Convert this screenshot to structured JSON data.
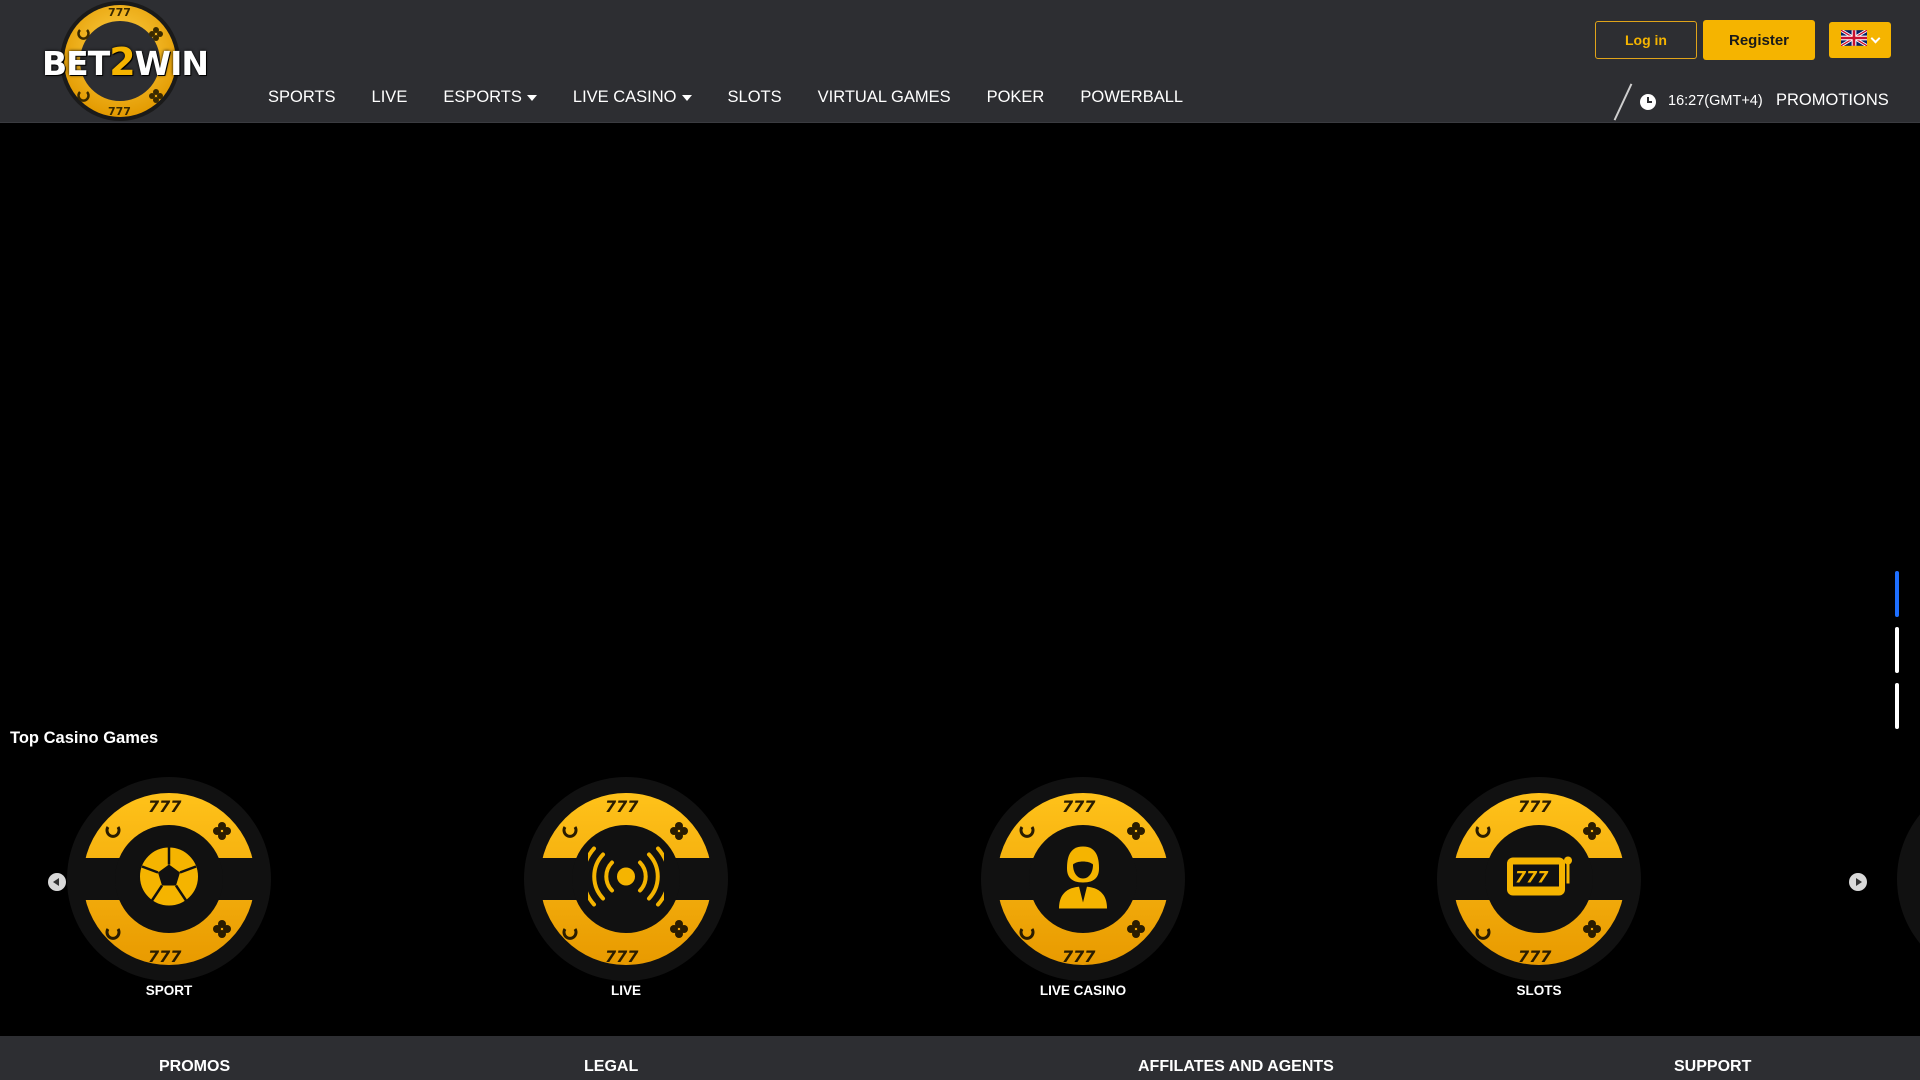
{
  "brand": {
    "name_part1": "BET",
    "name_part2": "2",
    "name_part3": "WIN",
    "accent": "#f5b400",
    "header_bg": "#2d2e32"
  },
  "nav": {
    "items": [
      {
        "label": "SPORTS",
        "has_dropdown": false
      },
      {
        "label": "LIVE",
        "has_dropdown": false
      },
      {
        "label": "ESPORTS",
        "has_dropdown": true
      },
      {
        "label": "LIVE CASINO",
        "has_dropdown": true
      },
      {
        "label": "SLOTS",
        "has_dropdown": false
      },
      {
        "label": "VIRTUAL GAMES",
        "has_dropdown": false
      },
      {
        "label": "POKER",
        "has_dropdown": false
      },
      {
        "label": "POWERBALL",
        "has_dropdown": false
      }
    ],
    "clock": "16:27(GMT+4)",
    "promotions": "PROMOTIONS"
  },
  "auth": {
    "login_label": "Log in",
    "register_label": "Register",
    "language_icon": "uk-flag-icon"
  },
  "hero": {
    "slides": 3,
    "active_slide": 1
  },
  "top_games": {
    "title": "Top Casino Games",
    "items": [
      {
        "label": "SPORT",
        "icon": "soccer-ball-icon"
      },
      {
        "label": "LIVE",
        "icon": "live-broadcast-icon"
      },
      {
        "label": "LIVE CASINO",
        "icon": "dealer-icon"
      },
      {
        "label": "SLOTS",
        "icon": "slot-machine-icon"
      }
    ]
  },
  "footer": {
    "columns": [
      {
        "title": "PROMOS"
      },
      {
        "title": "LEGAL"
      },
      {
        "title": "AFFILATES AND AGENTS"
      },
      {
        "title": "SUPPORT"
      }
    ]
  }
}
